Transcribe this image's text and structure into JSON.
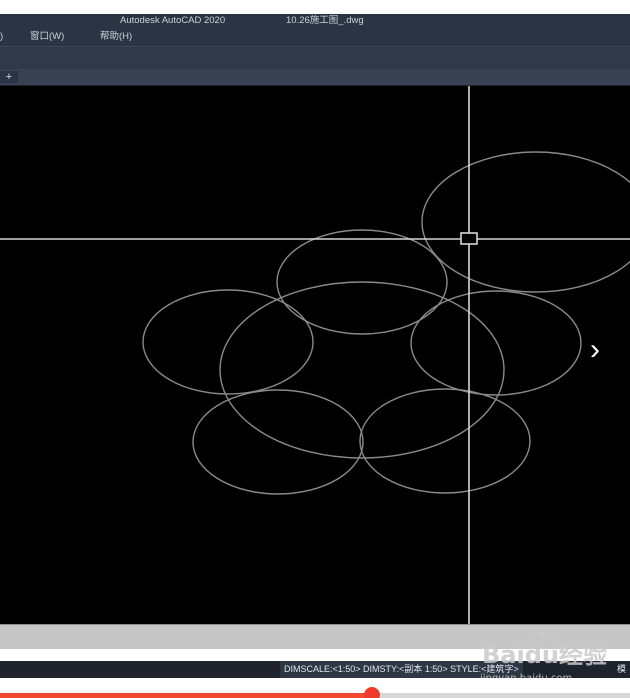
{
  "window": {
    "app_title": "Autodesk AutoCAD 2020",
    "document_title": "10.26施工图_.dwg"
  },
  "menu": {
    "items": [
      {
        "label": ")"
      },
      {
        "label": "窗口(W)"
      },
      {
        "label": "帮助(H)"
      }
    ]
  },
  "tabs": {
    "new_tab_symbol": "+"
  },
  "viewer": {
    "next_arrow": "›"
  },
  "statusbar": {
    "text": "DIMSCALE:<1:50> DIMSTY:<副本 1:50> STYLE:<建筑字>",
    "extra": "模"
  },
  "watermark": {
    "brand": "Baidu经验",
    "url": "jingyan.baidu.com"
  },
  "video": {
    "progress": 0.59
  },
  "colors": {
    "canvas": "#000000",
    "crosshair": "#d6d6d6",
    "circles": "#8a8a8a",
    "chrome": "#2b3442",
    "progress_accent": "#f04a30"
  }
}
